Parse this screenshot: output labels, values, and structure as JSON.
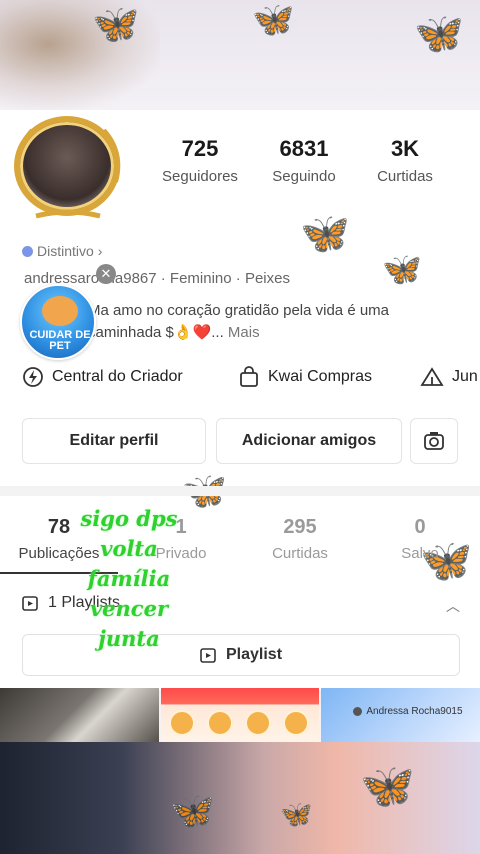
{
  "profile": {
    "stats": [
      {
        "value": "725",
        "label": "Seguidores"
      },
      {
        "value": "6831",
        "label": "Seguindo"
      },
      {
        "value": "3K",
        "label": "Curtidas"
      }
    ],
    "badge_label": "Distintivo",
    "user_line": "andressarocha9867 · Feminino · Peixes",
    "bio": "Ma amo no coração gratidão pela vida é uma caminhada $👌❤️...",
    "bio_more": "Mais",
    "pet_badge_label": "CUIDAR DE PET"
  },
  "tools": [
    {
      "label": "Central do Criador",
      "icon": "lightning-icon"
    },
    {
      "label": "Kwai Compras",
      "icon": "shopping-bag-icon"
    },
    {
      "label": "Jun",
      "icon": "tent-icon"
    }
  ],
  "actions": {
    "edit_profile": "Editar perfil",
    "add_friends": "Adicionar amigos",
    "settings_icon": "camera-icon"
  },
  "content_tabs": [
    {
      "count": "78",
      "label": "Publicações"
    },
    {
      "count": "1",
      "label": "Privado"
    },
    {
      "count": "295",
      "label": "Curtidas"
    },
    {
      "count": "0",
      "label": "Salvo"
    }
  ],
  "playlists": {
    "summary": "1 Playlists",
    "button_label": "Playlist"
  },
  "overlay_text": [
    "sigo dps",
    "volta",
    "família",
    "vencer",
    "junta"
  ],
  "thumbnails": [
    {
      "kind": "video"
    },
    {
      "kind": "promo"
    },
    {
      "kind": "post",
      "author": "Andressa Rocha9015"
    }
  ]
}
